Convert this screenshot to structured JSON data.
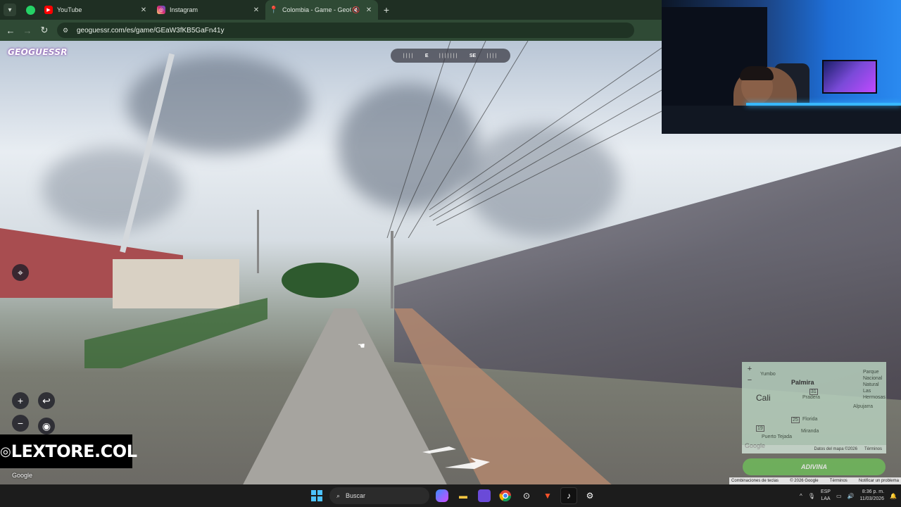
{
  "browser": {
    "tabs": [
      {
        "label": "YouTube",
        "favicon": "youtube-icon",
        "color": "#ff0000"
      },
      {
        "label": "Instagram",
        "favicon": "instagram-icon",
        "color": "#d62976"
      },
      {
        "label": "Colombia - Game - GeoGu",
        "favicon": "map-pin-icon",
        "color": "#e53935",
        "active": true
      }
    ],
    "url": "geoguessr.com/es/game/GEaW3fKB5GaFn41y"
  },
  "game": {
    "logo": "GEOGUESSR",
    "compass": [
      "E",
      "SE"
    ],
    "watermark_handle": "LEXTORE.COL",
    "google_label": "Google",
    "guess_button": "ADIVINA"
  },
  "minimap": {
    "places": {
      "yumbo": "Yumbo",
      "palmira": "Palmira",
      "cali": "Cali",
      "pradera": "Pradera",
      "florida": "Florida",
      "miranda": "Miranda",
      "puerto_tejada": "Puerto Tejada",
      "parque": "Parque Nacional Natural Las Hermosas",
      "alpujarra": "Alpujarra"
    },
    "roads": [
      "31",
      "25",
      "19"
    ],
    "google": "Google",
    "attribution": "Datos del mapa ©2026",
    "terms": "Términos"
  },
  "footer": {
    "shortcuts": "Combinaciones de teclas",
    "copyright": "© 2026 Google",
    "terms": "Términos",
    "report": "Notificar un problema"
  },
  "taskbar": {
    "search_placeholder": "Buscar",
    "lang_top": "ESP",
    "lang_bottom": "LAA",
    "time": "8:36 p. m.",
    "date": "11/03/2026"
  }
}
